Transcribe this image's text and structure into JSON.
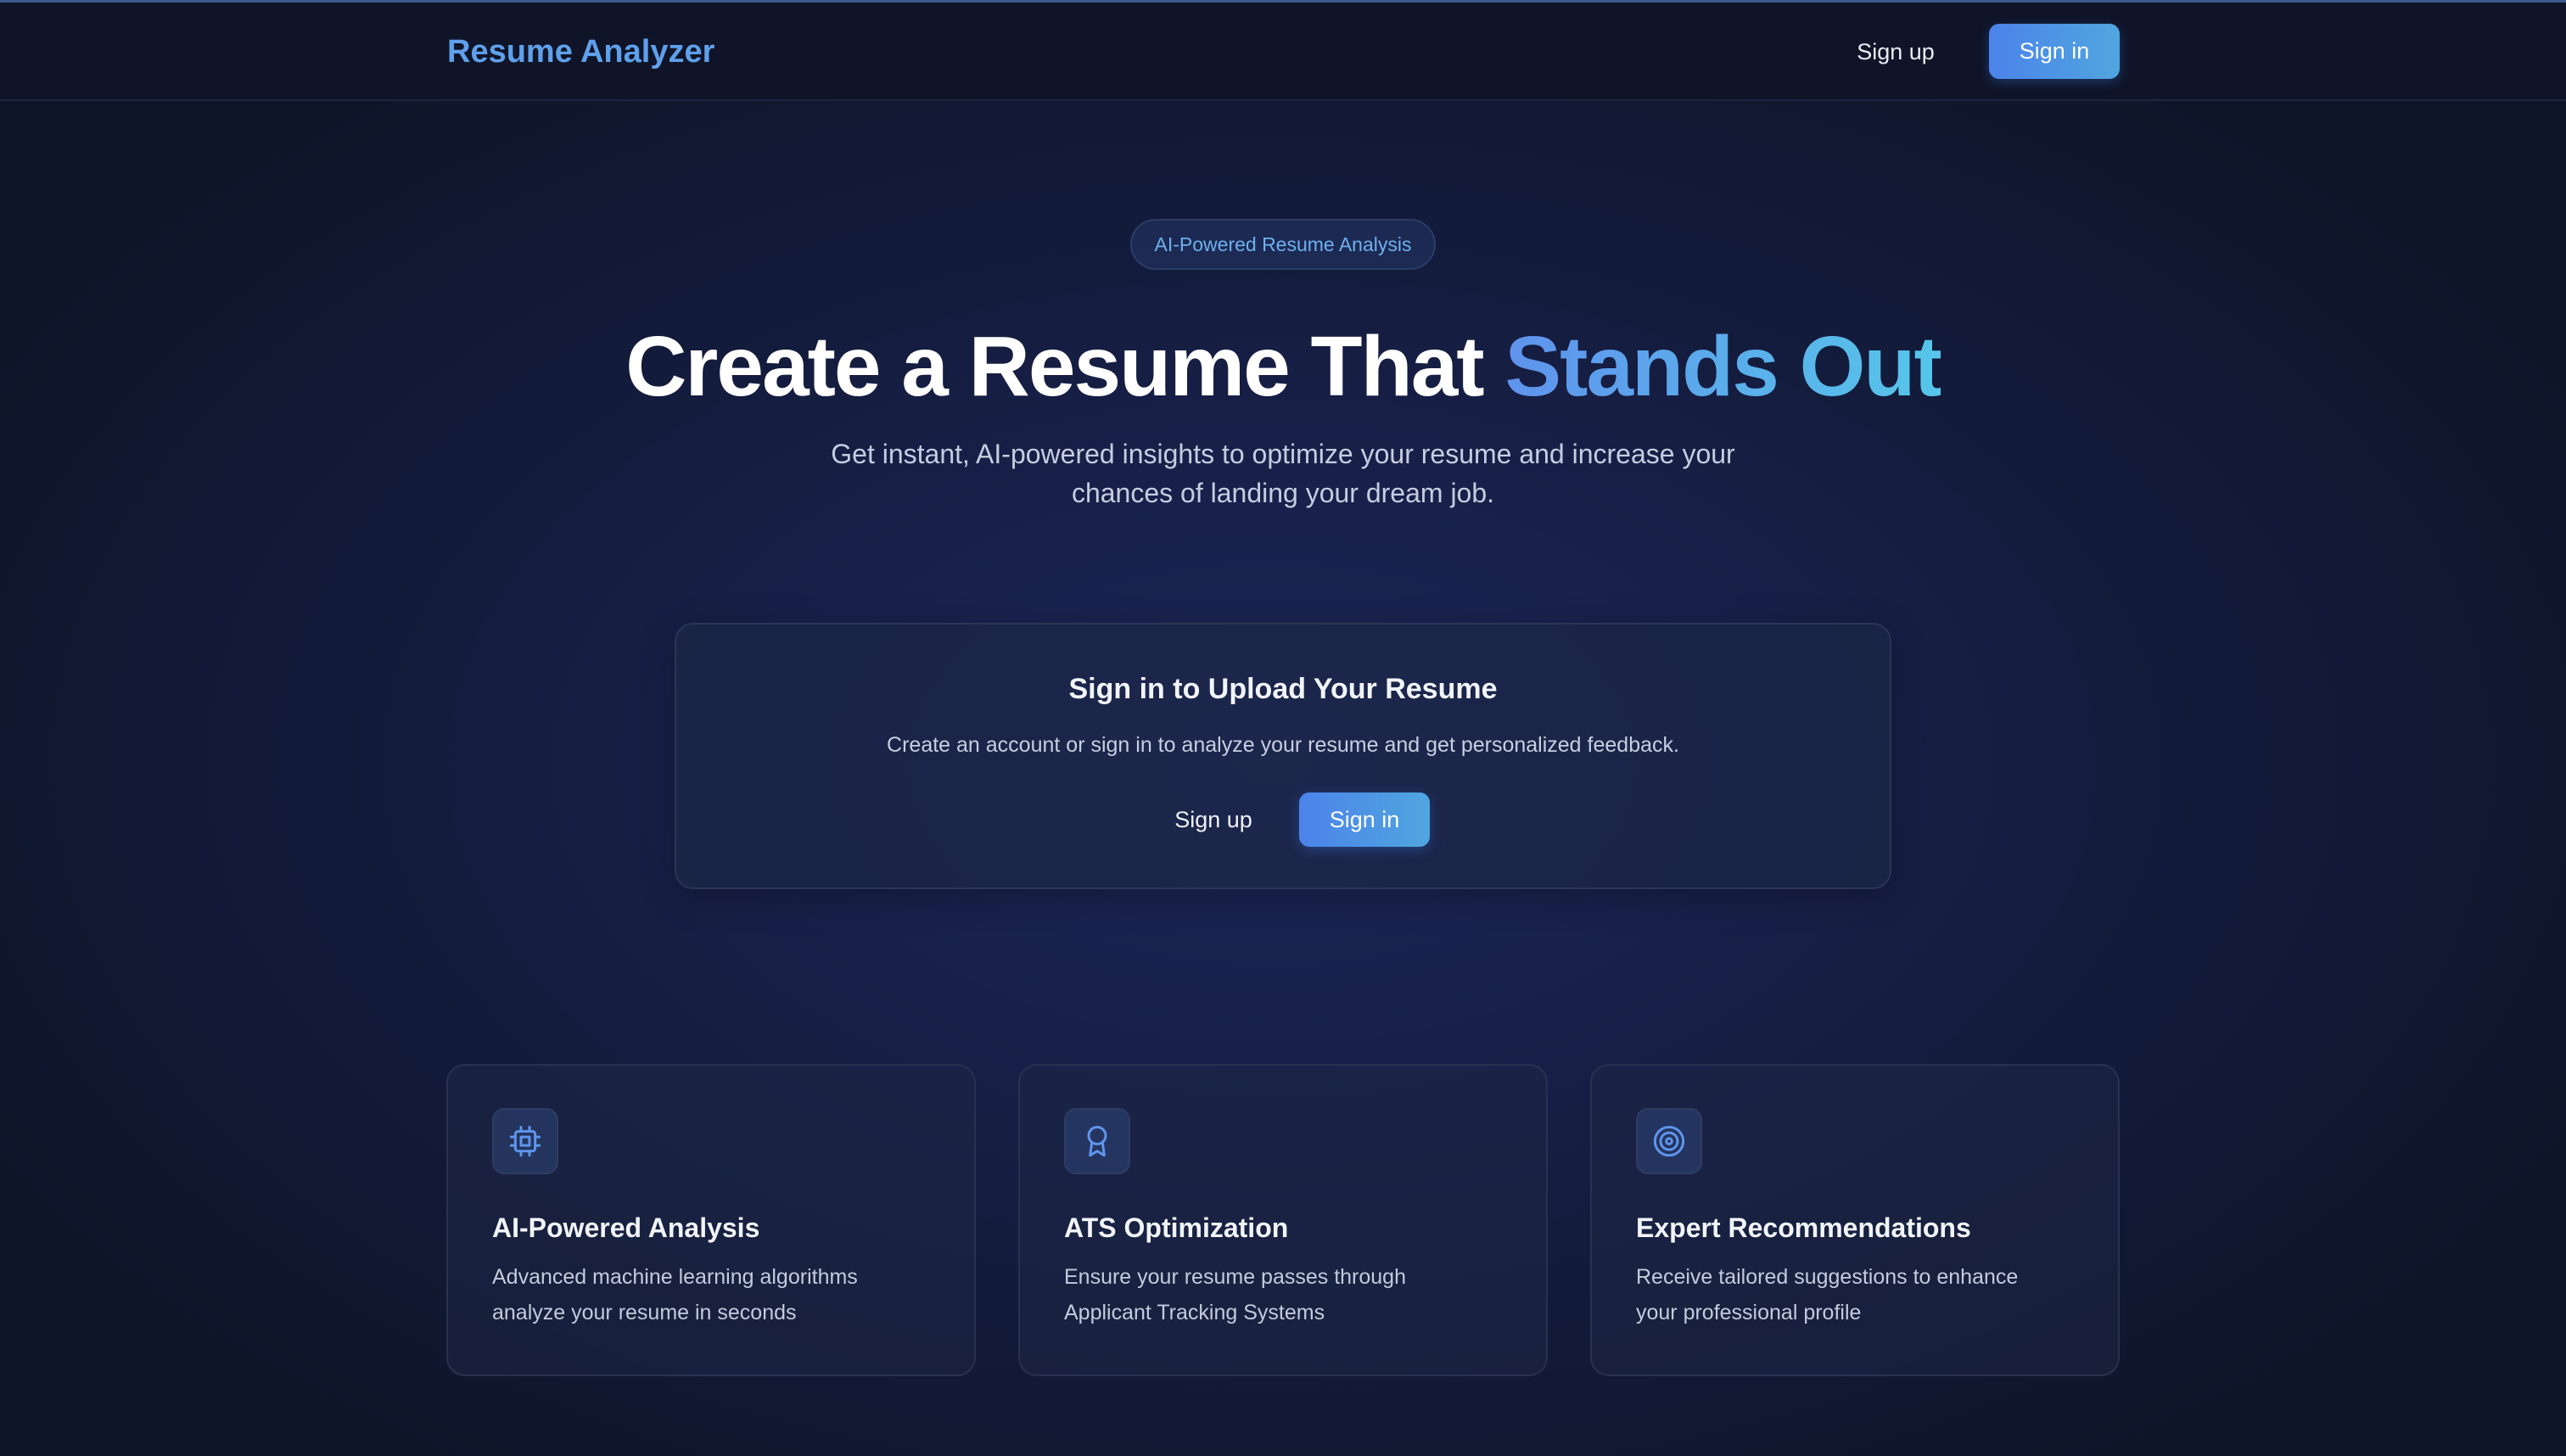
{
  "header": {
    "brand": "Resume Analyzer",
    "signup_label": "Sign up",
    "signin_label": "Sign in"
  },
  "hero": {
    "badge": "AI-Powered Resume Analysis",
    "title_main": "Create a Resume That ",
    "title_accent": "Stands Out",
    "subtitle": "Get instant, AI-powered insights to optimize your resume and increase your chances of landing your dream job."
  },
  "upload_card": {
    "title": "Sign in to Upload Your Resume",
    "description": "Create an account or sign in to analyze your resume and get personalized feedback.",
    "signup_label": "Sign up",
    "signin_label": "Sign in"
  },
  "features": [
    {
      "icon": "cpu-icon",
      "title": "AI-Powered Analysis",
      "description": "Advanced machine learning algorithms analyze your resume in seconds"
    },
    {
      "icon": "award-icon",
      "title": "ATS Optimization",
      "description": "Ensure your resume passes through Applicant Tracking Systems"
    },
    {
      "icon": "target-icon",
      "title": "Expert Recommendations",
      "description": "Receive tailored suggestions to enhance your professional profile"
    }
  ],
  "colors": {
    "accent": "#5fa0ea",
    "button_gradient_start": "#4c83ea",
    "button_gradient_end": "#50a6df",
    "background": "#141c3c"
  }
}
